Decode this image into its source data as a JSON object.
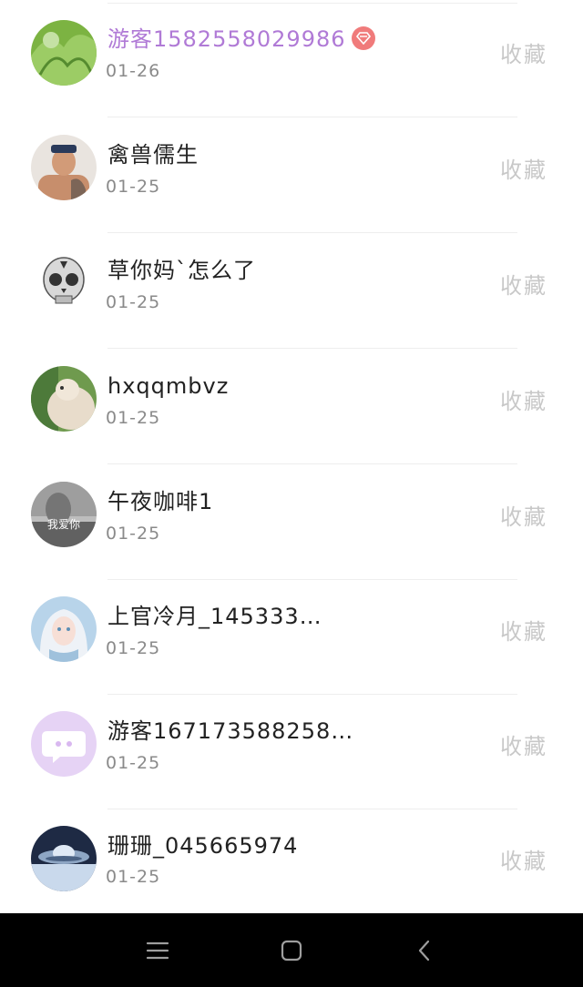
{
  "favorite_label": "收藏",
  "users": [
    {
      "name": "游客1582558029986",
      "date": "01-26",
      "vip": true,
      "avatar": "lettuce-avatar"
    },
    {
      "name": "禽兽儒生",
      "date": "01-25",
      "vip": false,
      "avatar": "man-avatar"
    },
    {
      "name": "草你妈`怎么了",
      "date": "01-25",
      "vip": false,
      "avatar": "skull-avatar"
    },
    {
      "name": "hxqqmbvz",
      "date": "01-25",
      "vip": false,
      "avatar": "capybara-avatar"
    },
    {
      "name": "午夜咖啡1",
      "date": "01-25",
      "vip": false,
      "avatar": "bw-photo-avatar",
      "avatar_text": "我爱你"
    },
    {
      "name": "上官冷月_145333…",
      "date": "01-25",
      "vip": false,
      "avatar": "anime-girl-avatar"
    },
    {
      "name": "游客167173588258…",
      "date": "01-25",
      "vip": false,
      "avatar": "default-chat-avatar"
    },
    {
      "name": "珊珊_045665974",
      "date": "01-25",
      "vip": false,
      "avatar": "ufo-avatar"
    }
  ],
  "colors": {
    "vip_name": "#b07ad6",
    "vip_badge": "#f07b7b",
    "favorite_text": "#c8c8c8",
    "date_text": "#8a8a8a",
    "nav_bar": "#000000"
  },
  "navbar": {
    "menu_icon": "menu-icon",
    "home_icon": "home-icon",
    "back_icon": "back-icon"
  }
}
